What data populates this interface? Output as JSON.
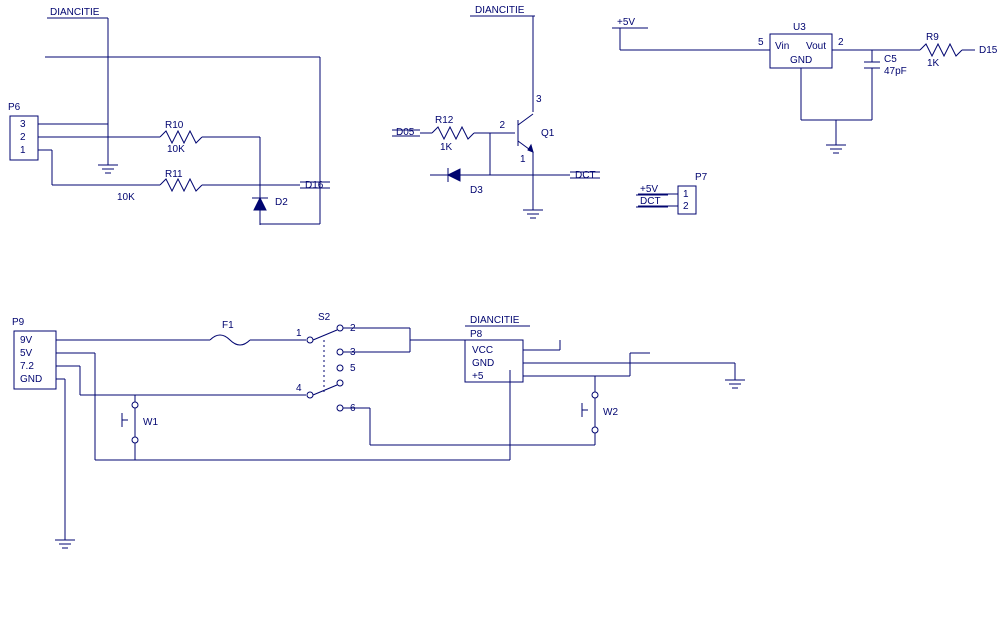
{
  "labels": {
    "net_dianchi1": "DIANCITIE",
    "net_dianchi2": "DIANCITIE",
    "net_dianchi3": "DIANCITIE",
    "net_plus5v": "+5V",
    "net_plus5v_p7": "+5V",
    "net_dct_p7": "DCT",
    "net_dct": "DCT",
    "net_d05": "D05",
    "net_d16": "D16",
    "net_d15": "D15",
    "p6_ref": "P6",
    "p6_pin3": "3",
    "p6_pin2": "2",
    "p6_pin1": "1",
    "p7_ref": "P7",
    "p7_pin1": "1",
    "p7_pin2": "2",
    "p8_ref": "P8",
    "p8_vcc": "VCC",
    "p8_gnd": "GND",
    "p8_p5": "+5",
    "p9_ref": "P9",
    "p9_9v": "9V",
    "p9_5v": "5V",
    "p9_72": "7.2",
    "p9_gnd": "GND",
    "u3_ref": "U3",
    "u3_vin": "Vin",
    "u3_vout": "Vout",
    "u3_gnd": "GND",
    "u3_pin5": "5",
    "u3_pin2": "2",
    "r9_ref": "R9",
    "r9_val": "1K",
    "r10_ref": "R10",
    "r10_val": "10K",
    "r11_ref": "R11",
    "r11_val": "10K",
    "r12_ref": "R12",
    "r12_val": "1K",
    "c5_ref": "C5",
    "c5_val": "47pF",
    "d2_ref": "D2",
    "d3_ref": "D3",
    "q1_ref": "Q1",
    "q1_pin1": "1",
    "q1_pin2": "2",
    "q1_pin3": "3",
    "f1_ref": "F1",
    "s2_ref": "S2",
    "s2_1": "1",
    "s2_2": "2",
    "s2_3": "3",
    "s2_4": "4",
    "s2_5": "5",
    "s2_6": "6",
    "w1_ref": "W1",
    "w2_ref": "W2"
  }
}
